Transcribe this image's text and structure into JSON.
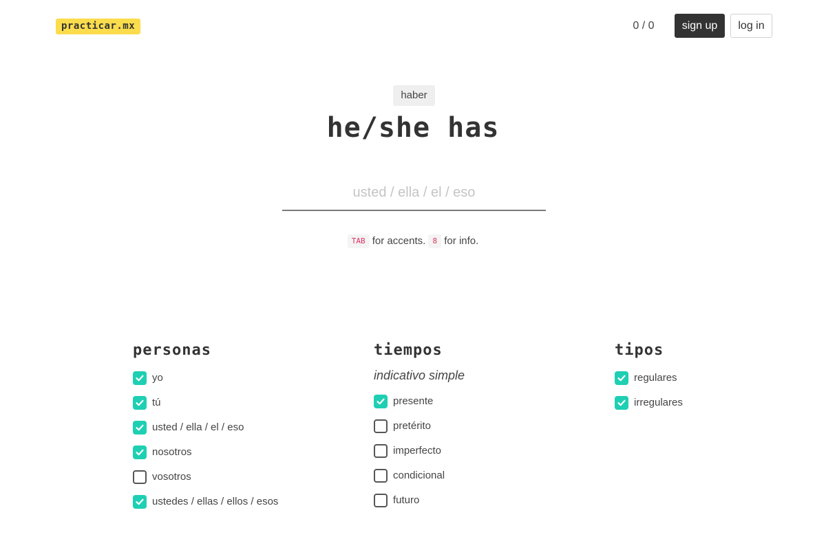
{
  "header": {
    "logo": "practicar.mx",
    "score": "0 / 0",
    "signup_label": "sign up",
    "login_label": "log in"
  },
  "exercise": {
    "verb": "haber",
    "prompt": "he/she has",
    "answer_value": "",
    "answer_placeholder": "usted / ella / el / eso",
    "hint": {
      "key1": "TAB",
      "text1": "for accents.",
      "key2": "8",
      "text2": "for info."
    }
  },
  "personas": {
    "title": "personas",
    "options": [
      {
        "label": "yo",
        "checked": true
      },
      {
        "label": "tú",
        "checked": true
      },
      {
        "label": "usted / ella / el / eso",
        "checked": true
      },
      {
        "label": "nosotros",
        "checked": true
      },
      {
        "label": "vosotros",
        "checked": false
      },
      {
        "label": "ustedes / ellas / ellos / esos",
        "checked": true
      }
    ]
  },
  "tiempos": {
    "title": "tiempos",
    "subheading": "indicativo simple",
    "options": [
      {
        "label": "presente",
        "checked": true
      },
      {
        "label": "pretérito",
        "checked": false
      },
      {
        "label": "imperfecto",
        "checked": false
      },
      {
        "label": "condicional",
        "checked": false
      },
      {
        "label": "futuro",
        "checked": false
      }
    ]
  },
  "tipos": {
    "title": "tipos",
    "options": [
      {
        "label": "regulares",
        "checked": true
      },
      {
        "label": "irregulares",
        "checked": true
      }
    ]
  },
  "colors": {
    "logo_bg": "#fbdc4c",
    "checkbox_on": "#1fcfb3",
    "key_text": "#e0315f",
    "dark_button": "#333333"
  },
  "icons": {
    "checkbox_checked": "check-icon"
  }
}
